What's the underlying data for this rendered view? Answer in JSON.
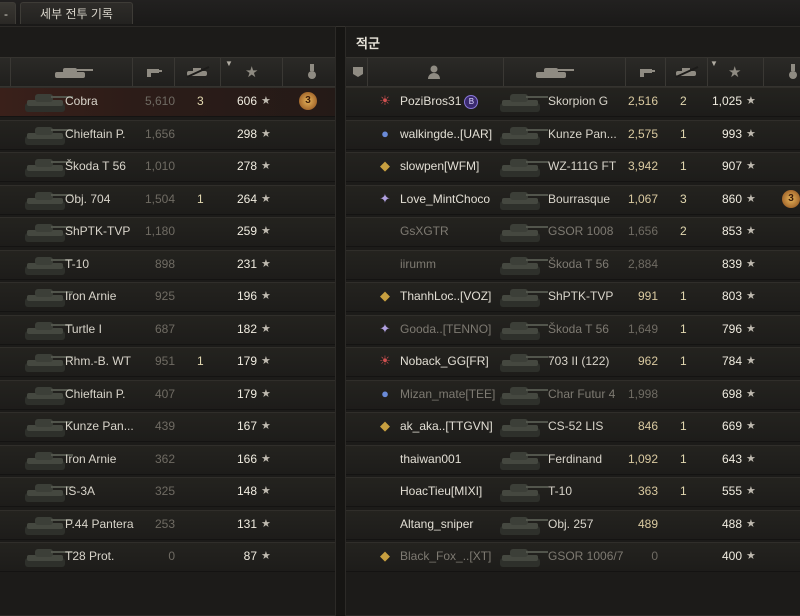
{
  "tabs": [
    {
      "label": "-",
      "active": true
    },
    {
      "label": "세부 전투 기록",
      "active": false
    }
  ],
  "enemy_team": {
    "title": "적군"
  },
  "columns": {
    "icons": [
      "clan-icon",
      "player-icon",
      "tank-icon",
      "damage-icon",
      "kills-icon",
      "xp-star-icon",
      "medal-icon"
    ],
    "sorted_by": "xp"
  },
  "left_rows": [
    {
      "tank": "Cobra",
      "damage": "5,610",
      "kills": "3",
      "xp": "606",
      "medal": "3",
      "highlight": true
    },
    {
      "tank": "Chieftain P.",
      "damage": "1,656",
      "kills": "",
      "xp": "298"
    },
    {
      "tank": "Škoda T 56",
      "damage": "1,010",
      "kills": "",
      "xp": "278"
    },
    {
      "tank": "Obj. 704",
      "damage": "1,504",
      "kills": "1",
      "xp": "264"
    },
    {
      "tank": "ShPTK-TVP",
      "damage": "1,180",
      "kills": "",
      "xp": "259"
    },
    {
      "tank": "T-10",
      "damage": "898",
      "kills": "",
      "xp": "231"
    },
    {
      "tank": "Iron Arnie",
      "damage": "925",
      "kills": "",
      "xp": "196"
    },
    {
      "tank": "Turtle I",
      "damage": "687",
      "kills": "",
      "xp": "182"
    },
    {
      "tank": "Rhm.-B. WT",
      "damage": "951",
      "kills": "1",
      "xp": "179"
    },
    {
      "tank": "Chieftain P.",
      "damage": "407",
      "kills": "",
      "xp": "179"
    },
    {
      "tank": "Kunze Pan...",
      "damage": "439",
      "kills": "",
      "xp": "167"
    },
    {
      "tank": "Iron Arnie",
      "damage": "362",
      "kills": "",
      "xp": "166"
    },
    {
      "tank": "IS-3A",
      "damage": "325",
      "kills": "",
      "xp": "148"
    },
    {
      "tank": "P.44 Pantera",
      "damage": "253",
      "kills": "",
      "xp": "131"
    },
    {
      "tank": "T28 Prot.",
      "damage": "0",
      "kills": "",
      "xp": "87"
    }
  ],
  "right_rows": [
    {
      "player": "PoziBros31",
      "clan_icon": "clan-emblem",
      "badge": "B",
      "tank": "Skorpion G",
      "damage": "2,516",
      "kills": "2",
      "xp": "1,025",
      "alive": true
    },
    {
      "player": "walkingde..[UAR]",
      "clan_icon": "clan-emblem",
      "tank": "Kunze Pan...",
      "damage": "2,575",
      "kills": "1",
      "xp": "993",
      "alive": true
    },
    {
      "player": "slowpen[WFM]",
      "clan_icon": "clan-emblem",
      "tank": "WZ-111G FT",
      "damage": "3,942",
      "kills": "1",
      "xp": "907",
      "alive": true
    },
    {
      "player": "Love_MintChoco",
      "clan_icon": "clan-emblem",
      "tank": "Bourrasque",
      "damage": "1,067",
      "kills": "3",
      "xp": "860",
      "alive": true,
      "medal": "3"
    },
    {
      "player": "GsXGTR",
      "tank": "GSOR 1008",
      "damage": "1,656",
      "kills": "2",
      "xp": "853",
      "alive": false
    },
    {
      "player": "iirumm",
      "tank": "Škoda T 56",
      "damage": "2,884",
      "kills": "",
      "xp": "839",
      "alive": false
    },
    {
      "player": "ThanhLoc..[VOZ]",
      "clan_icon": "clan-emblem",
      "tank": "ShPTK-TVP",
      "damage": "991",
      "kills": "1",
      "xp": "803",
      "alive": true
    },
    {
      "player": "Gooda..[TENNO]",
      "clan_icon": "clan-emblem",
      "tank": "Škoda T 56",
      "damage": "1,649",
      "kills": "1",
      "xp": "796",
      "alive": false
    },
    {
      "player": "Noback_GG[FR]",
      "clan_icon": "clan-emblem",
      "tank": "703 II (122)",
      "damage": "962",
      "kills": "1",
      "xp": "784",
      "alive": true
    },
    {
      "player": "Mizan_mate[TEE]",
      "clan_icon": "clan-emblem",
      "tank": "Char Futur 4",
      "damage": "1,998",
      "kills": "",
      "xp": "698",
      "alive": false
    },
    {
      "player": "ak_aka..[TTGVN]",
      "clan_icon": "clan-emblem",
      "tank": "CS-52 LIS",
      "damage": "846",
      "kills": "1",
      "xp": "669",
      "alive": true
    },
    {
      "player": "thaiwan001",
      "tank": "Ferdinand",
      "damage": "1,092",
      "kills": "1",
      "xp": "643",
      "alive": true
    },
    {
      "player": "HoacTieu[MIXI]",
      "tank": "T-10",
      "damage": "363",
      "kills": "1",
      "xp": "555",
      "alive": true
    },
    {
      "player": "Altang_sniper",
      "tank": "Obj. 257",
      "damage": "489",
      "kills": "",
      "xp": "488",
      "alive": true
    },
    {
      "player": "Black_Fox_..[XT]",
      "clan_icon": "clan-emblem",
      "tank": "GSOR 1006/7",
      "damage": "0",
      "kills": "",
      "xp": "400",
      "alive": false
    }
  ]
}
